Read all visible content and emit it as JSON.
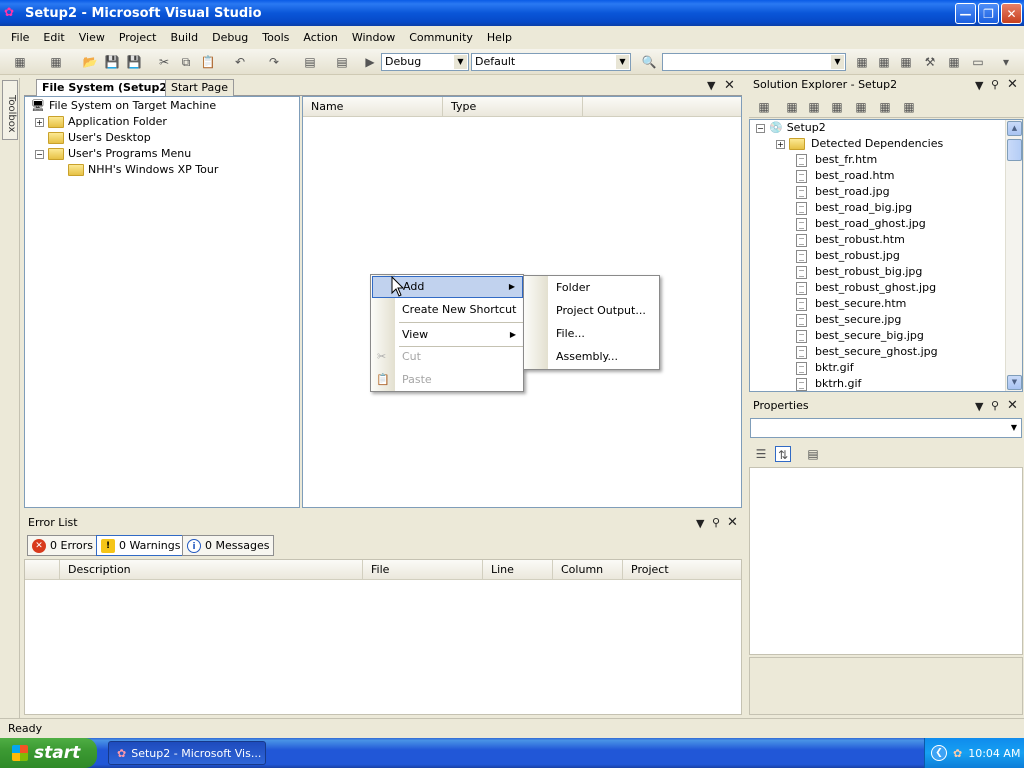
{
  "window": {
    "title": "Setup2 - Microsoft Visual Studio"
  },
  "menubar": [
    "File",
    "Edit",
    "View",
    "Project",
    "Build",
    "Debug",
    "Tools",
    "Action",
    "Window",
    "Community",
    "Help"
  ],
  "toolbar": {
    "config_value": "Debug",
    "platform_value": "Default"
  },
  "toolbox": {
    "label": "Toolbox"
  },
  "doc_tabs": [
    {
      "label": "File System (Setup2)",
      "active": true
    },
    {
      "label": "Start Page",
      "active": false
    }
  ],
  "file_system_tree": {
    "root": "File System on Target Machine",
    "items": [
      "Application Folder",
      "User's Desktop",
      "User's Programs Menu"
    ],
    "child": "NHH's Windows XP Tour"
  },
  "list_columns": [
    "Name",
    "Type"
  ],
  "context_menu": {
    "items": [
      {
        "label": "Add",
        "submenu": true,
        "highlighted": true
      },
      {
        "label": "Create New Shortcut"
      },
      {
        "label": "View",
        "submenu": true
      },
      {
        "label": "Cut",
        "disabled": true
      },
      {
        "label": "Paste",
        "disabled": true
      }
    ]
  },
  "add_submenu": {
    "items": [
      "Folder",
      "Project Output...",
      "File...",
      "Assembly..."
    ]
  },
  "solution_explorer": {
    "title": "Solution Explorer - Setup2",
    "project": "Setup2",
    "dependencies": "Detected Dependencies",
    "files": [
      "best_fr.htm",
      "best_road.htm",
      "best_road.jpg",
      "best_road_big.jpg",
      "best_road_ghost.jpg",
      "best_robust.htm",
      "best_robust.jpg",
      "best_robust_big.jpg",
      "best_robust_ghost.jpg",
      "best_secure.htm",
      "best_secure.jpg",
      "best_secure_big.jpg",
      "best_secure_ghost.jpg",
      "bktr.gif",
      "bktrh.gif"
    ]
  },
  "properties": {
    "title": "Properties"
  },
  "error_list": {
    "title": "Error List",
    "errors": "0 Errors",
    "warnings": "0 Warnings",
    "messages": "0 Messages",
    "columns": [
      "Description",
      "File",
      "Line",
      "Column",
      "Project"
    ]
  },
  "status": "Ready",
  "taskbar": {
    "start": "start",
    "task": "Setup2 - Microsoft Vis...",
    "clock": "10:04 AM"
  },
  "colors": {
    "highlight": "#c1d2ee",
    "highlight_border": "#316ac5",
    "titlebar": "#0a56d8"
  }
}
